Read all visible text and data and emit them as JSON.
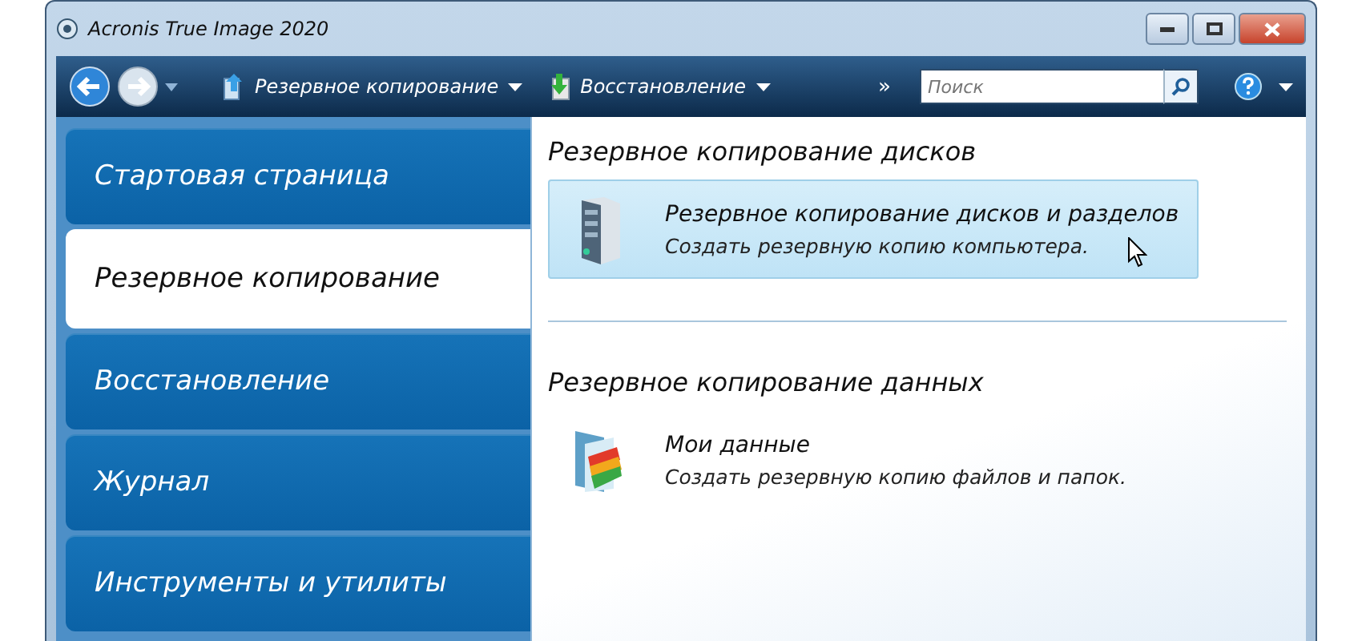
{
  "window": {
    "title": "Acronis True Image 2020"
  },
  "toolbar": {
    "menus": [
      {
        "label": "Резервное копирование",
        "kind": "backup"
      },
      {
        "label": "Восстановление",
        "kind": "restore"
      }
    ],
    "overflow": "»",
    "search": {
      "placeholder": "Поиск"
    }
  },
  "sidebar": {
    "items": [
      {
        "label": "Стартовая страница",
        "selected": false
      },
      {
        "label": "Резервное копирование",
        "selected": true
      },
      {
        "label": "Восстановление",
        "selected": false
      },
      {
        "label": "Журнал",
        "selected": false
      },
      {
        "label": "Инструменты и утилиты",
        "selected": false
      }
    ]
  },
  "sections": [
    {
      "title": "Резервное копирование дисков",
      "items": [
        {
          "kind": "server",
          "title": "Резервное копирование дисков и разделов",
          "description": "Создать резервную копию компьютера.",
          "highlighted": true
        }
      ]
    },
    {
      "title": "Резервное копирование данных",
      "items": [
        {
          "kind": "folder",
          "title": "Мои данные",
          "description": "Создать резервную копию файлов и папок.",
          "highlighted": false
        }
      ]
    }
  ]
}
